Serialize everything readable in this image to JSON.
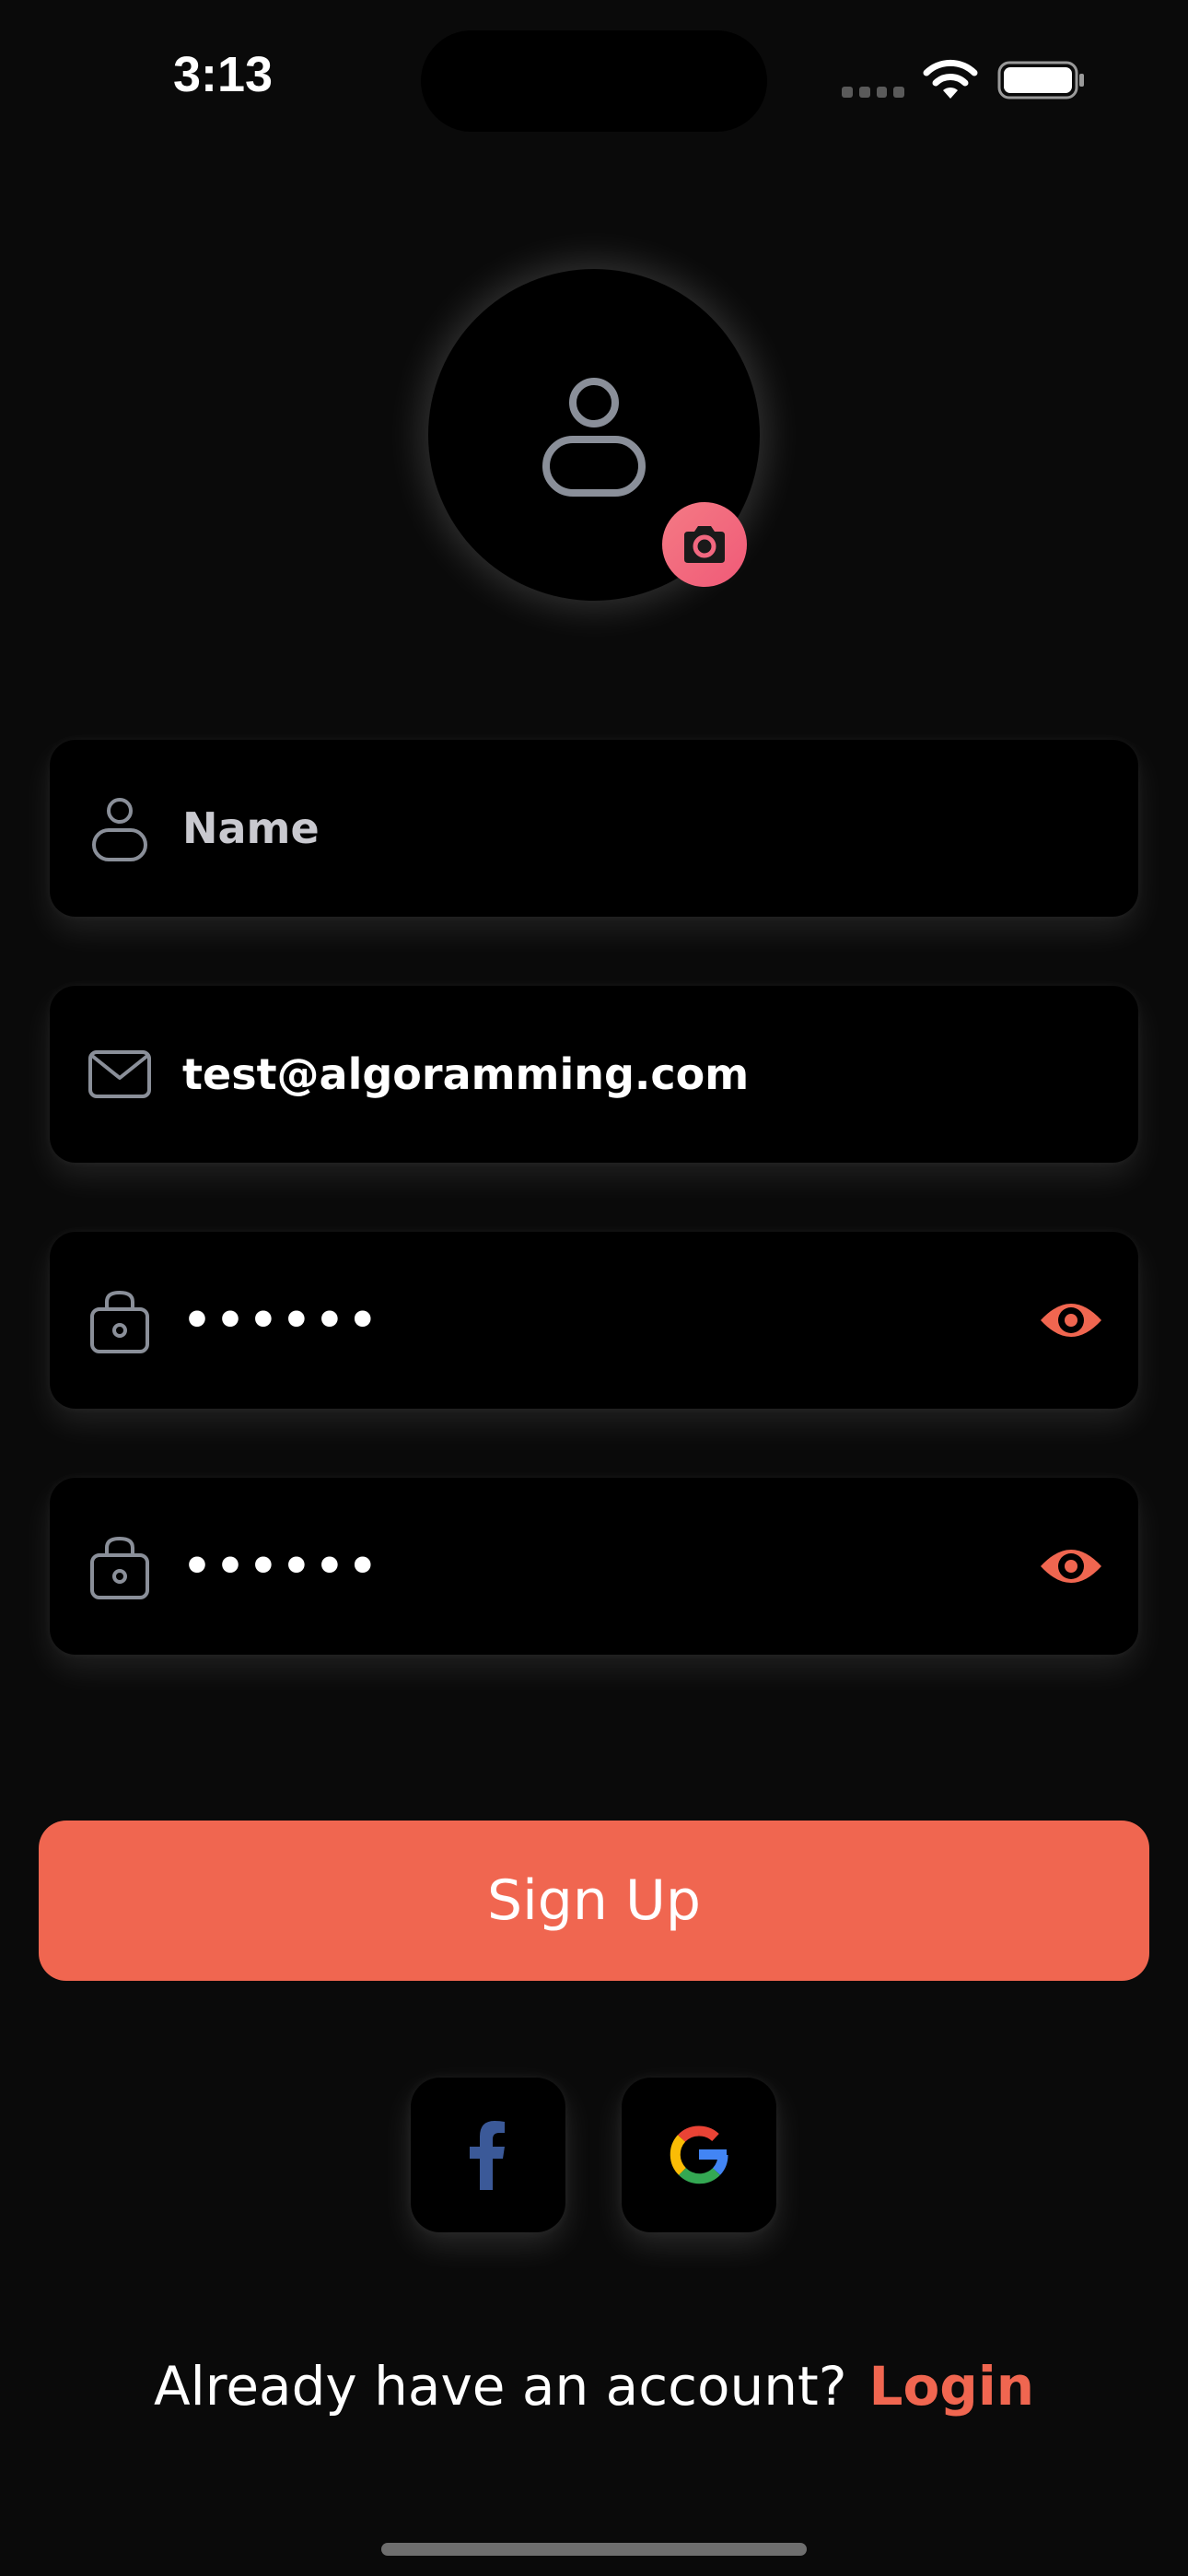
{
  "status_bar": {
    "time": "3:13"
  },
  "avatar": {
    "placeholder_icon": "person-icon",
    "edit_icon": "camera-icon"
  },
  "form": {
    "name": {
      "placeholder": "Name",
      "icon": "person-icon"
    },
    "email": {
      "value": "test@algoramming.com",
      "icon": "mail-icon"
    },
    "password": {
      "value": "••••••",
      "icon": "lock-icon",
      "toggle_icon": "eye-icon"
    },
    "confirm_password": {
      "value": "••••••",
      "icon": "lock-icon",
      "toggle_icon": "eye-icon"
    }
  },
  "signup_button": {
    "label": "Sign Up"
  },
  "social": {
    "facebook_icon": "facebook-icon",
    "google_icon": "google-icon"
  },
  "footer": {
    "prompt": "Already have an account?",
    "login_label": "Login"
  },
  "colors": {
    "background": "#0a0a0a",
    "field_background": "#000000",
    "accent": "#f06650",
    "camera_badge": "#f26880",
    "icon_gray": "#8a8f99"
  }
}
